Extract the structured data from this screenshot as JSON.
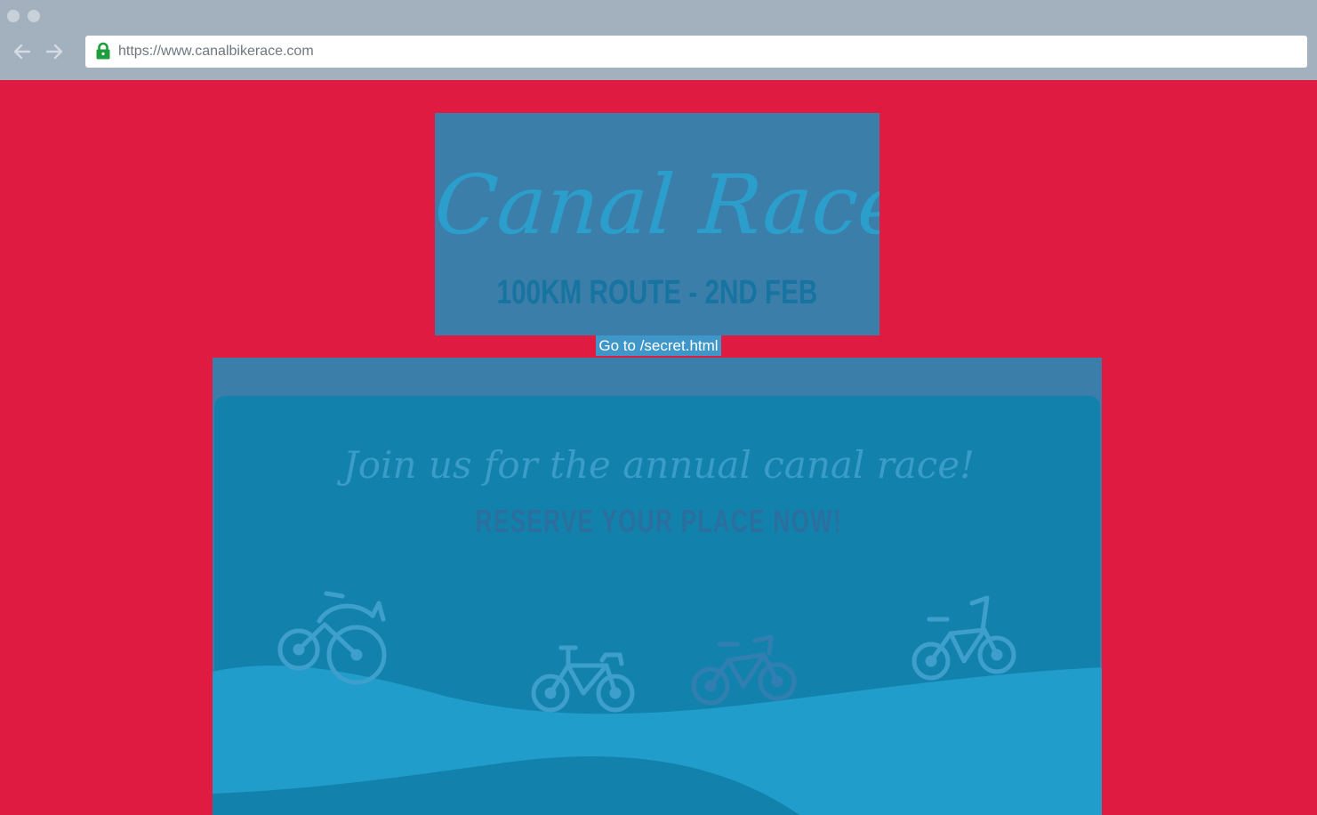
{
  "browser": {
    "url": "https://www.canalbikerace.com",
    "back_icon": "arrow-left-icon",
    "forward_icon": "arrow-right-icon",
    "secure_icon": "lock-icon",
    "chrome_color": "#a3b1bf"
  },
  "hero": {
    "title": "Canal Race",
    "subtitle": "100KM ROUTE - 2ND FEB"
  },
  "secret_link": {
    "label": "Go to /secret.html"
  },
  "banner": {
    "heading": "Join us for the annual canal race!",
    "cta": "RESERVE YOUR PLACE NOW!",
    "illustration_icons": [
      "tricycle-icon",
      "bicycle-icon",
      "mountain-bike-icon",
      "kids-bike-icon"
    ]
  },
  "colors": {
    "page_background": "#e01b42",
    "card_background": "#3a7ea9",
    "panel_background": "#1282ad",
    "wave_color": "#209dcb",
    "link_background": "#3f97c9",
    "secure_green": "#1e9e3a"
  }
}
